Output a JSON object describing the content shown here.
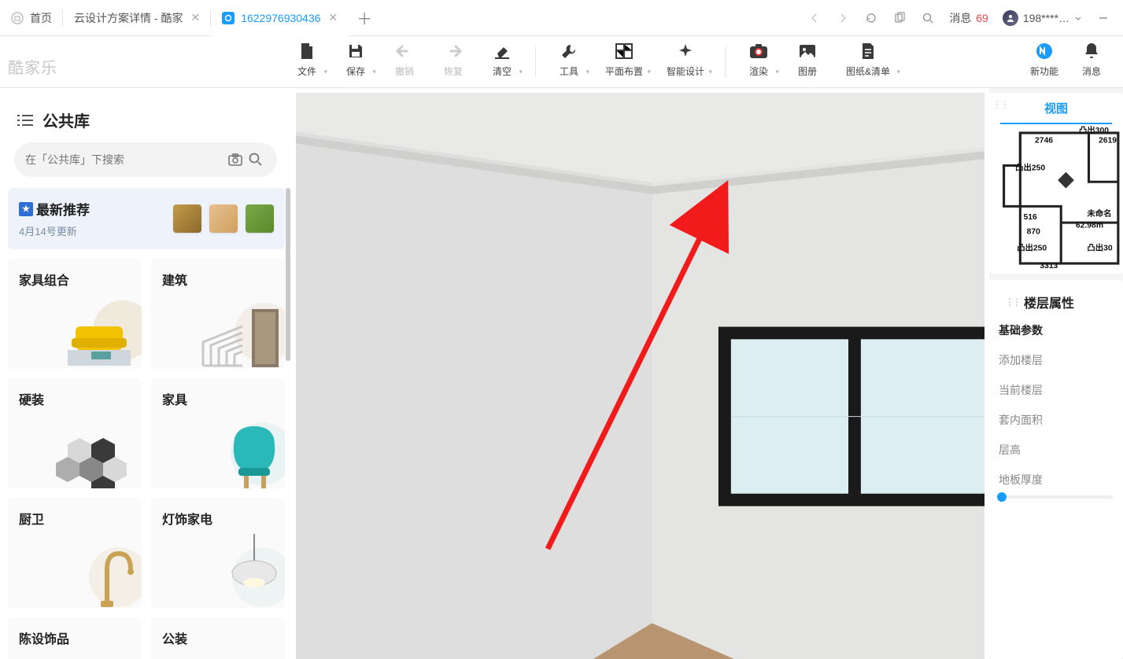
{
  "tabs": {
    "home_label": "首页",
    "t1_label": "云设计方案详情 - 酷家",
    "t2_label": "1622976930436"
  },
  "topbar": {
    "msg_label": "消息",
    "msg_count": "69",
    "user_label": "198****…"
  },
  "brand": "酷家乐",
  "toolbar": {
    "file": "文件",
    "save": "保存",
    "undo": "撤销",
    "redo": "恢复",
    "clear": "清空",
    "tools": "工具",
    "plan": "平面布置",
    "smart": "智能设计",
    "render": "渲染",
    "album": "图册",
    "drawings": "图纸&清单",
    "new_feature": "新功能",
    "message": "消息"
  },
  "sidebar": {
    "title": "公共库",
    "search_placeholder": "在「公共库」下搜索",
    "featured": {
      "title": "最新推荐",
      "subtitle": "4月14号更新"
    },
    "categories": [
      {
        "title": "家具组合"
      },
      {
        "title": "建筑"
      },
      {
        "title": "硬装"
      },
      {
        "title": "家具"
      },
      {
        "title": "厨卫"
      },
      {
        "title": "灯饰家电"
      },
      {
        "title": "陈设饰品"
      },
      {
        "title": "公装"
      }
    ]
  },
  "right": {
    "view_tab": "视图",
    "minimap": {
      "labels": [
        "凸出300",
        "2619",
        "2746",
        "凸出250",
        "未命名",
        "62.98m",
        "870",
        "凸出250",
        "凸出30",
        "516",
        "3313"
      ]
    },
    "properties": {
      "title": "楼层属性",
      "section": "基础参数",
      "rows": {
        "add_floor": "添加楼层",
        "current_floor": "当前楼层",
        "inner_area": "套内面积",
        "height": "层高",
        "floor_thickness": "地板厚度"
      }
    }
  }
}
